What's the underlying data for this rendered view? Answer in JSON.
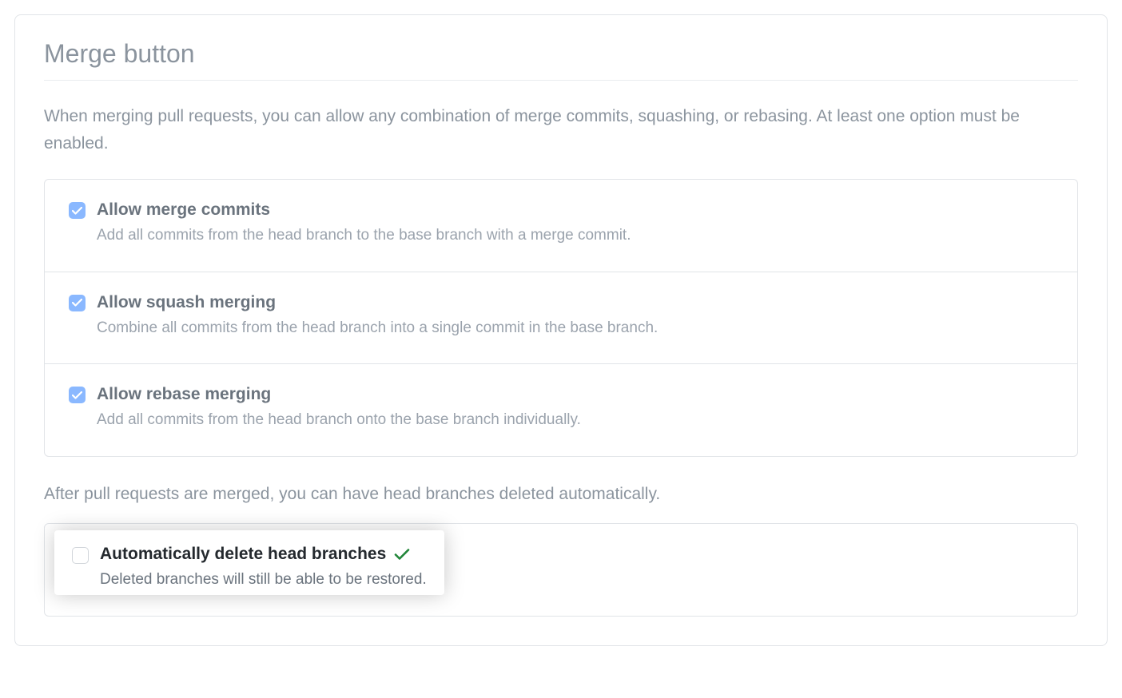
{
  "section": {
    "title": "Merge button",
    "intro": "When merging pull requests, you can allow any combination of merge commits, squashing, or rebasing. At least one option must be enabled.",
    "options": [
      {
        "checked": true,
        "label": "Allow merge commits",
        "desc": "Add all commits from the head branch to the base branch with a merge commit."
      },
      {
        "checked": true,
        "label": "Allow squash merging",
        "desc": "Combine all commits from the head branch into a single commit in the base branch."
      },
      {
        "checked": true,
        "label": "Allow rebase merging",
        "desc": "Add all commits from the head branch onto the base branch individually."
      }
    ],
    "sub_intro": "After pull requests are merged, you can have head branches deleted automatically.",
    "auto_delete": {
      "checked": false,
      "label": "Automatically delete head branches",
      "desc": "Deleted branches will still be able to be restored.",
      "confirmed": true
    }
  }
}
